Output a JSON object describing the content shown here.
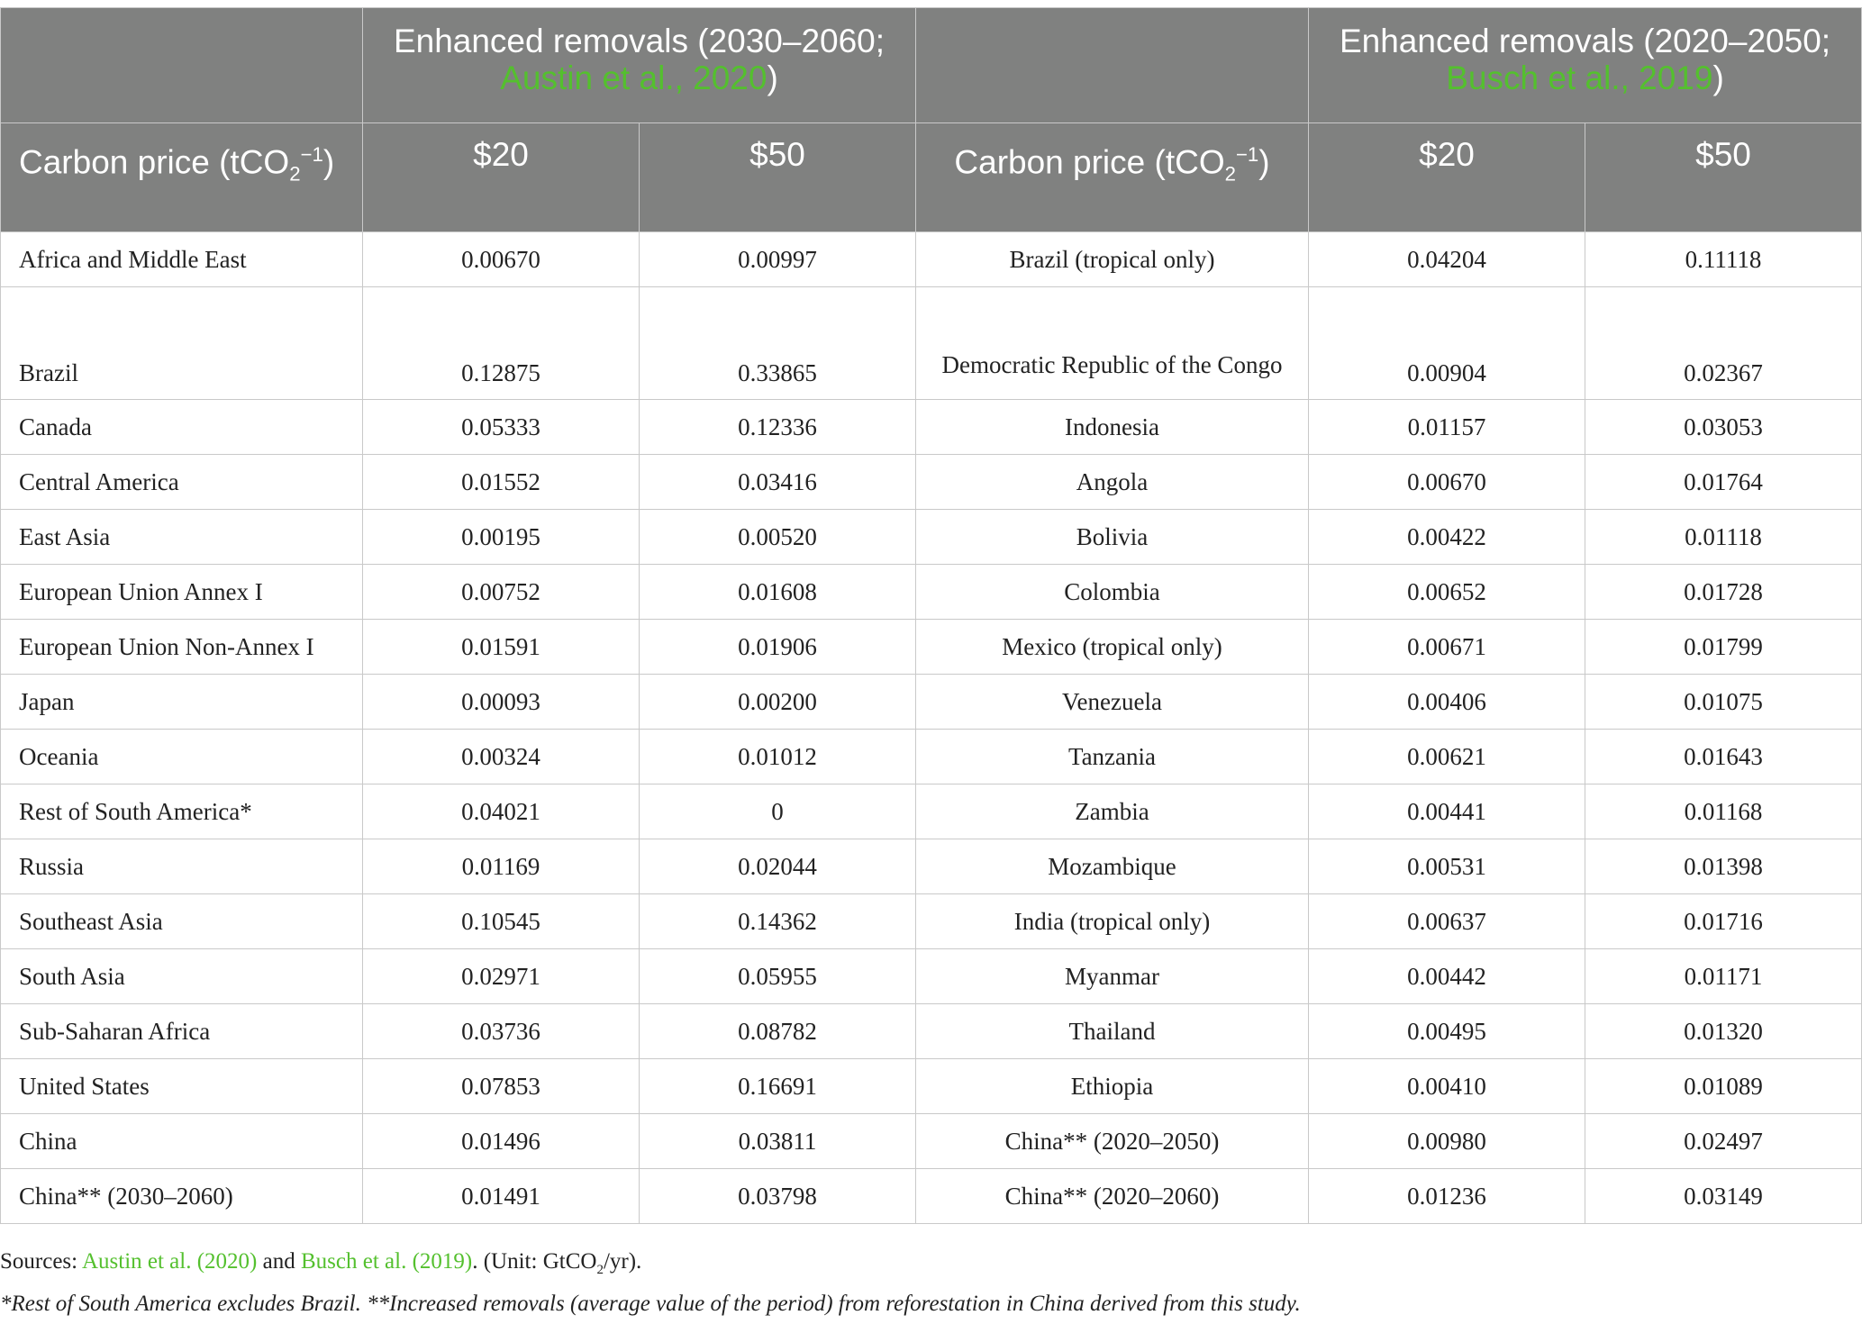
{
  "header": {
    "group_left_prefix": "Enhanced removals (2030–2060; ",
    "group_left_cite": "Austin et al., 2020",
    "group_left_suffix": ")",
    "group_right_prefix": "Enhanced removals (2020–2050; ",
    "group_right_cite": "Busch et al., 2019",
    "group_right_suffix": ")",
    "carbon_price_label": "Carbon price (tCO",
    "carbon_price_sub": "2",
    "carbon_price_sup": "−1",
    "carbon_price_close": ")",
    "price_20": "$20",
    "price_50": "$50"
  },
  "rows": [
    {
      "region_a": "Africa and Middle East",
      "a20": "0.00670",
      "a50": "0.00997",
      "region_b": "Brazil (tropical only)",
      "b20": "0.04204",
      "b50": "0.11118"
    },
    {
      "region_a": "Brazil",
      "a20": "0.12875",
      "a50": "0.33865",
      "region_b": "Democratic Republic of the Congo",
      "b20": "0.00904",
      "b50": "0.02367"
    },
    {
      "region_a": "Canada",
      "a20": "0.05333",
      "a50": "0.12336",
      "region_b": "Indonesia",
      "b20": "0.01157",
      "b50": "0.03053"
    },
    {
      "region_a": "Central America",
      "a20": "0.01552",
      "a50": "0.03416",
      "region_b": "Angola",
      "b20": "0.00670",
      "b50": "0.01764"
    },
    {
      "region_a": "East Asia",
      "a20": "0.00195",
      "a50": "0.00520",
      "region_b": "Bolivia",
      "b20": "0.00422",
      "b50": "0.01118"
    },
    {
      "region_a": "European Union Annex I",
      "a20": "0.00752",
      "a50": "0.01608",
      "region_b": "Colombia",
      "b20": "0.00652",
      "b50": "0.01728"
    },
    {
      "region_a": "European Union Non-Annex I",
      "a20": "0.01591",
      "a50": "0.01906",
      "region_b": "Mexico (tropical only)",
      "b20": "0.00671",
      "b50": "0.01799"
    },
    {
      "region_a": "Japan",
      "a20": "0.00093",
      "a50": "0.00200",
      "region_b": "Venezuela",
      "b20": "0.00406",
      "b50": "0.01075"
    },
    {
      "region_a": "Oceania",
      "a20": "0.00324",
      "a50": "0.01012",
      "region_b": "Tanzania",
      "b20": "0.00621",
      "b50": "0.01643"
    },
    {
      "region_a": "Rest of South America*",
      "a20": "0.04021",
      "a50": "0",
      "region_b": "Zambia",
      "b20": "0.00441",
      "b50": "0.01168"
    },
    {
      "region_a": "Russia",
      "a20": "0.01169",
      "a50": "0.02044",
      "region_b": "Mozambique",
      "b20": "0.00531",
      "b50": "0.01398"
    },
    {
      "region_a": "Southeast Asia",
      "a20": "0.10545",
      "a50": "0.14362",
      "region_b": "India (tropical only)",
      "b20": "0.00637",
      "b50": "0.01716"
    },
    {
      "region_a": "South Asia",
      "a20": "0.02971",
      "a50": "0.05955",
      "region_b": "Myanmar",
      "b20": "0.00442",
      "b50": "0.01171"
    },
    {
      "region_a": "Sub-Saharan Africa",
      "a20": "0.03736",
      "a50": "0.08782",
      "region_b": "Thailand",
      "b20": "0.00495",
      "b50": "0.01320"
    },
    {
      "region_a": "United States",
      "a20": "0.07853",
      "a50": "0.16691",
      "region_b": "Ethiopia",
      "b20": "0.00410",
      "b50": "0.01089"
    },
    {
      "region_a": "China",
      "a20": "0.01496",
      "a50": "0.03811",
      "region_b": "China** (2020–2050)",
      "b20": "0.00980",
      "b50": "0.02497"
    },
    {
      "region_a": "China** (2030–2060)",
      "a20": "0.01491",
      "a50": "0.03798",
      "region_b": "China** (2020–2060)",
      "b20": "0.01236",
      "b50": "0.03149"
    }
  ],
  "notes": {
    "sources_label": "Sources: ",
    "source_1": "Austin et al. (2020)",
    "and": " and ",
    "source_2": "Busch et al. (2019)",
    "unit_prefix": ". (Unit: GtCO",
    "unit_sub": "2",
    "unit_suffix": "/yr).",
    "footnote": "*Rest of South America excludes Brazil. **Increased removals (average value of the period) from reforestation in China derived from this study."
  },
  "colors": {
    "header_bg": "#808180",
    "header_text": "#ffffff",
    "citation_green": "#54c02e",
    "grid_line": "#c9c9c9"
  }
}
